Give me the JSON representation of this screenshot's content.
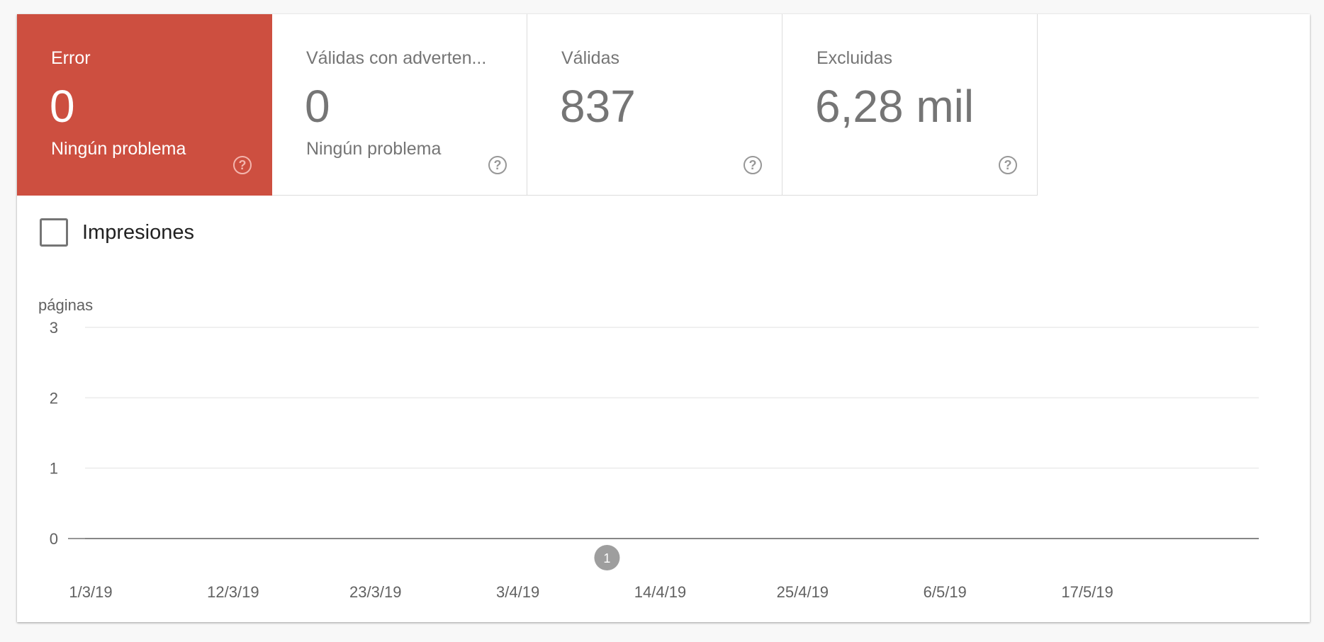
{
  "tiles": [
    {
      "label": "Error",
      "value": "0",
      "sub": "Ningún problema",
      "help": "?"
    },
    {
      "label": "Válidas con adverten...",
      "value": "0",
      "sub": "Ningún problema",
      "help": "?"
    },
    {
      "label": "Válidas",
      "value": "837",
      "sub": "",
      "help": "?"
    },
    {
      "label": "Excluidas",
      "value": "6,28 mil",
      "sub": "",
      "help": "?"
    }
  ],
  "impressions": {
    "label": "Impresiones",
    "checked": false
  },
  "colors": {
    "error_tile": "#cd4f40",
    "annotation": "#9e9e9e"
  },
  "chart_data": {
    "type": "line",
    "ylabel": "páginas",
    "ylim": [
      0,
      3
    ],
    "yticks": [
      "0",
      "1",
      "2",
      "3"
    ],
    "xlim_days": [
      0,
      92
    ],
    "xticks": [
      {
        "label": "1/3/19",
        "day": 0
      },
      {
        "label": "12/3/19",
        "day": 11
      },
      {
        "label": "23/3/19",
        "day": 22
      },
      {
        "label": "3/4/19",
        "day": 33
      },
      {
        "label": "14/4/19",
        "day": 44
      },
      {
        "label": "25/4/19",
        "day": 55
      },
      {
        "label": "6/5/19",
        "day": 66
      },
      {
        "label": "17/5/19",
        "day": 77
      }
    ],
    "series": [
      {
        "values": [
          0,
          0
        ]
      }
    ],
    "annotations": [
      {
        "label": "1",
        "day": 40
      }
    ]
  }
}
